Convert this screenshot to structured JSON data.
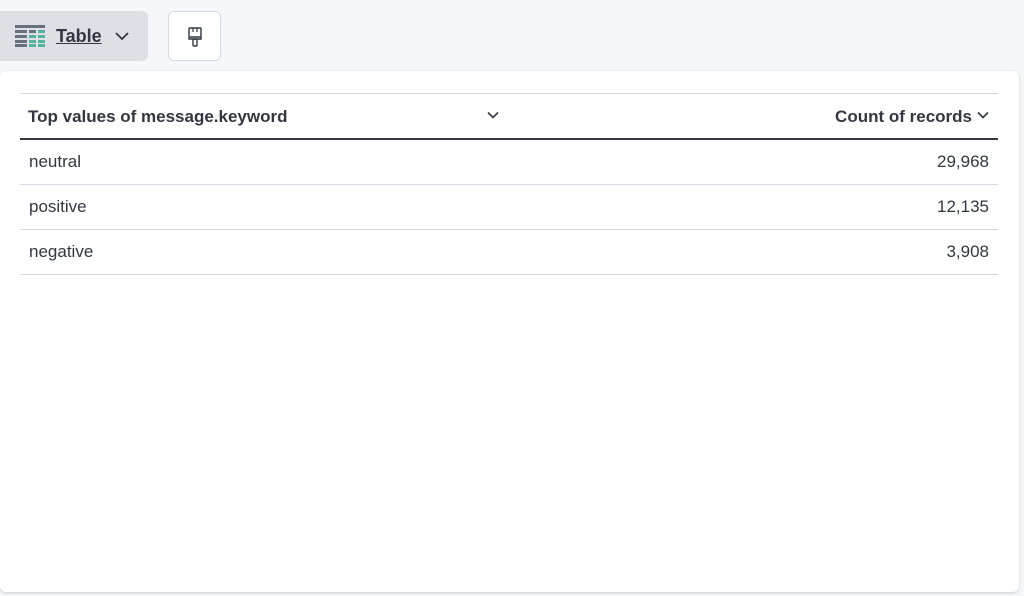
{
  "toolbar": {
    "visualization_label": "Table"
  },
  "table": {
    "columns": [
      {
        "label": "Top values of message.keyword"
      },
      {
        "label": "Count of records"
      }
    ],
    "rows": [
      {
        "value": "neutral",
        "count": "29,968"
      },
      {
        "value": "positive",
        "count": "12,135"
      },
      {
        "value": "negative",
        "count": "3,908"
      }
    ]
  },
  "icons": {
    "table_type": "table-icon",
    "style_button": "paintbrush-icon",
    "dropdown": "chevron-down-icon"
  },
  "colors": {
    "table_icon_dark": "#69707d",
    "table_icon_accent": "#54b399",
    "text": "#343741"
  }
}
